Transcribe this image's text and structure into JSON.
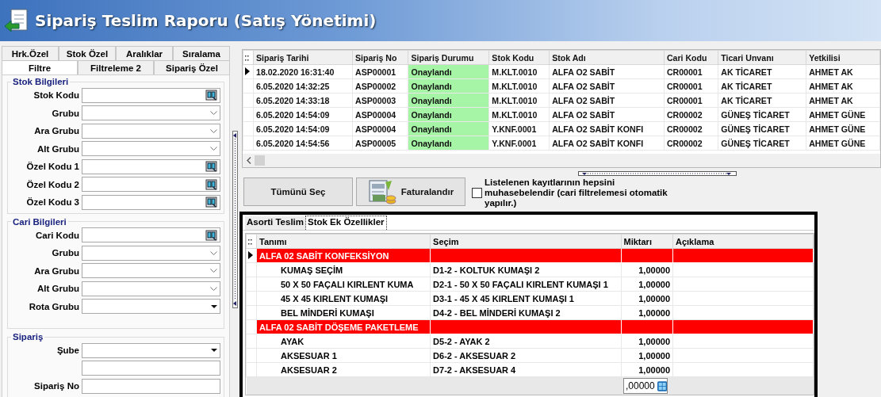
{
  "window": {
    "title": "Sipariş Teslim Raporu (Satış Yönetimi)"
  },
  "filter_panel": {
    "tab_rows": [
      {
        "tabs": [
          {
            "label": "Hrk.Özel",
            "selected": false
          },
          {
            "label": "Stok Özel",
            "selected": false
          },
          {
            "label": "Aralıklar",
            "selected": false
          },
          {
            "label": "Sıralama",
            "selected": false
          }
        ]
      },
      {
        "tabs": [
          {
            "label": "Filtre",
            "selected": true
          },
          {
            "label": "Filtreleme 2",
            "selected": false
          },
          {
            "label": "Sipariş Özel",
            "selected": false
          }
        ]
      }
    ],
    "groups": [
      {
        "title": "Stok Bilgileri",
        "fields": [
          {
            "label": "Stok Kodu",
            "kind": "lookup"
          },
          {
            "label": "Grubu",
            "kind": "combo"
          },
          {
            "label": "Ara Grubu",
            "kind": "combo"
          },
          {
            "label": "Alt Grubu",
            "kind": "combo"
          },
          {
            "label": "Özel Kodu 1",
            "kind": "lookup"
          },
          {
            "label": "Özel Kodu 2",
            "kind": "lookup"
          },
          {
            "label": "Özel Kodu 3",
            "kind": "lookup"
          }
        ]
      },
      {
        "title": "Cari Bilgileri",
        "fields": [
          {
            "label": "Cari Kodu",
            "kind": "lookup"
          },
          {
            "label": "Grubu",
            "kind": "combo"
          },
          {
            "label": "Ara Grubu",
            "kind": "combo"
          },
          {
            "label": "Alt Grubu",
            "kind": "combo"
          },
          {
            "label": "Rota Grubu",
            "kind": "dropdown"
          }
        ]
      },
      {
        "title": "Sipariş",
        "fields": [
          {
            "label": "Şube",
            "kind": "dropdown"
          },
          {
            "kind": "text"
          },
          {
            "label": "Sipariş No",
            "kind": "text"
          }
        ]
      }
    ]
  },
  "orders": {
    "columns": [
      "Sipariş Tarihi",
      "Sipariş No",
      "Sipariş Durumu",
      "Stok Kodu",
      "Stok Adı",
      "Cari Kodu",
      "Ticari Unvanı",
      "Yetkilisi"
    ],
    "rows": [
      {
        "selected": true,
        "cells": [
          "18.02.2020 16:31:40",
          "ASP00001",
          "Onaylandı",
          "M.KLT.0010",
          "ALFA O2 SABİT",
          "CR00001",
          "AK TİCARET",
          "AHMET AK"
        ]
      },
      {
        "selected": false,
        "cells": [
          "6.05.2020 14:32:25",
          "ASP00002",
          "Onaylandı",
          "M.KLT.0010",
          "ALFA O2 SABİT",
          "CR00001",
          "AK TİCARET",
          "AHMET AK"
        ]
      },
      {
        "selected": false,
        "cells": [
          "6.05.2020 14:33:18",
          "ASP00003",
          "Onaylandı",
          "M.KLT.0010",
          "ALFA O2 SABİT",
          "CR00001",
          "AK TİCARET",
          "AHMET AK"
        ]
      },
      {
        "selected": false,
        "cells": [
          "6.05.2020 14:54:09",
          "ASP00004",
          "Onaylandı",
          "M.KLT.0010",
          "ALFA O2 SABİT",
          "CR00002",
          "GÜNEŞ TİCARET",
          "AHMET GÜNE"
        ]
      },
      {
        "selected": false,
        "cells": [
          "6.05.2020 14:54:09",
          "ASP00004",
          "Onaylandı",
          "Y.KNF.0001",
          "ALFA O2 SABİT KONFI",
          "CR00002",
          "GÜNEŞ TİCARET",
          "AHMET GÜNE"
        ]
      },
      {
        "selected": false,
        "cells": [
          "6.05.2020 14:54:56",
          "ASP00005",
          "Onaylandı",
          "Y.KNF.0001",
          "ALFA O2 SABİT KONFI",
          "CR00002",
          "GÜNEŞ TİCARET",
          "AHMET GÜNE"
        ]
      }
    ]
  },
  "actions": {
    "buttons": [
      {
        "label": "Tümünü Seç",
        "kind": "plain"
      },
      {
        "label": "Faturalandır",
        "kind": "invoice"
      }
    ],
    "checkbox": {
      "label": "Listelenen kayıtlarının hepsini muhasebelendir (cari filtrelemesi otomatik yapılır.)",
      "checked": false
    }
  },
  "details": {
    "tabs": [
      {
        "label": "Asorti Teslim",
        "selected": false
      },
      {
        "label": "Stok Ek Özellikler",
        "selected": true
      }
    ],
    "columns": [
      "Tanımı",
      "Seçim",
      "Miktarı",
      "Açıklama"
    ],
    "rows": [
      {
        "kind": "group",
        "selected": true,
        "cells": [
          "ALFA 02 SABİT KONFEKSİYON"
        ]
      },
      {
        "kind": "item",
        "selected": false,
        "cells": [
          "KUMAŞ SEÇİM",
          "D1-2 - KOLTUK KUMAŞI 2",
          "1,00000"
        ]
      },
      {
        "kind": "item",
        "selected": false,
        "cells": [
          "50 X 50 FAÇALI KIRLENT KUMA",
          "D2-1 - 50 X 50 FAÇALI KIRLENT KUMAŞI 1",
          "1,00000"
        ]
      },
      {
        "kind": "item",
        "selected": false,
        "cells": [
          "45 X 45 KIRLENT KUMAŞI",
          "D3-1 - 45 X 45 KIRLENT KUMAŞI 1",
          "1,00000"
        ]
      },
      {
        "kind": "item",
        "selected": false,
        "cells": [
          "BEL MİNDERİ KUMAŞI",
          "D4-2 - BEL MİNDERİ KUMAŞI 2",
          "1,00000"
        ]
      },
      {
        "kind": "group",
        "selected": false,
        "cells": [
          "ALFA 02 SABİT DÖŞEME PAKETLEME"
        ]
      },
      {
        "kind": "item",
        "selected": false,
        "cells": [
          "AYAK",
          "D5-2 - AYAK 2",
          "1,00000"
        ]
      },
      {
        "kind": "item",
        "selected": false,
        "cells": [
          "AKSESUAR 1",
          "D6-2 - AKSESUAR 2",
          "1,00000"
        ]
      },
      {
        "kind": "item",
        "selected": false,
        "cells": [
          "AKSESUAR 2",
          "D7-2 - AKSESUAR 4",
          "1,00000"
        ]
      }
    ],
    "total": ",00000"
  }
}
